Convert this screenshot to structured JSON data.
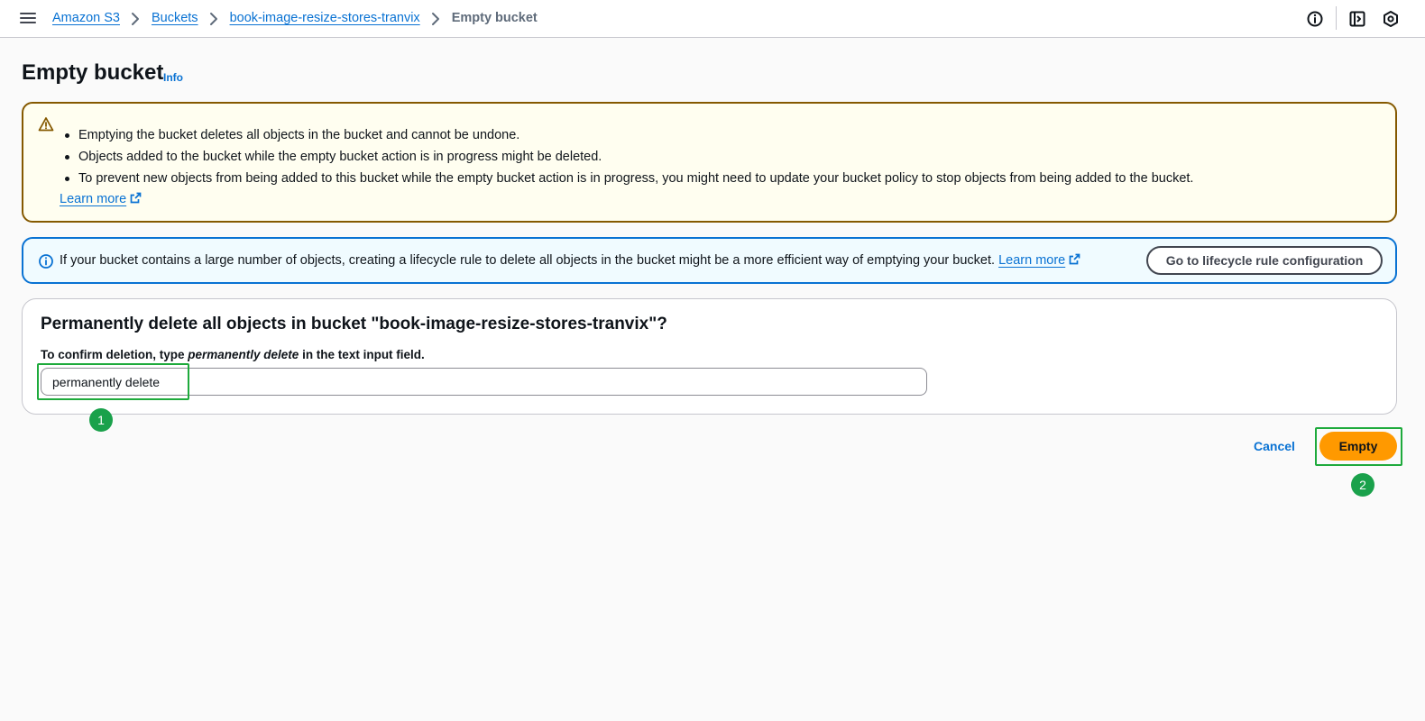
{
  "breadcrumb": {
    "items": [
      "Amazon S3",
      "Buckets",
      "book-image-resize-stores-tranvix"
    ],
    "current": "Empty bucket"
  },
  "page": {
    "title": "Empty bucket",
    "info_link": "Info"
  },
  "warning": {
    "bullets": [
      "Emptying the bucket deletes all objects in the bucket and cannot be undone.",
      "Objects added to the bucket while the empty bucket action is in progress might be deleted.",
      "To prevent new objects from being added to this bucket while the empty bucket action is in progress, you might need to update your bucket policy to stop objects from being added to the bucket."
    ],
    "learn_more": "Learn more"
  },
  "info_alert": {
    "text": "If your bucket contains a large number of objects, creating a lifecycle rule to delete all objects in the bucket might be a more efficient way of emptying your bucket.",
    "learn_more": "Learn more",
    "button_label": "Go to lifecycle rule configuration"
  },
  "confirm": {
    "heading": "Permanently delete all objects in bucket \"book-image-resize-stores-tranvix\"?",
    "label_before": "To confirm deletion, type ",
    "label_phrase": "permanently delete",
    "label_after": " in the text input field.",
    "input_value": "permanently delete"
  },
  "actions": {
    "cancel": "Cancel",
    "empty": "Empty"
  },
  "annotations": {
    "step1": "1",
    "step2": "2"
  },
  "colors": {
    "link": "#0972d3",
    "primary_button": "#ff9900",
    "warning_border": "#855900",
    "warning_bg": "#fffef0",
    "info_border": "#0972d3",
    "info_bg": "#f0fbff",
    "highlight": "#1eaa3c"
  },
  "icons": [
    "menu-icon",
    "chevron-right-icon",
    "info-circle-icon",
    "panel-icon",
    "settings-hex-icon",
    "warning-icon",
    "external-link-icon"
  ]
}
